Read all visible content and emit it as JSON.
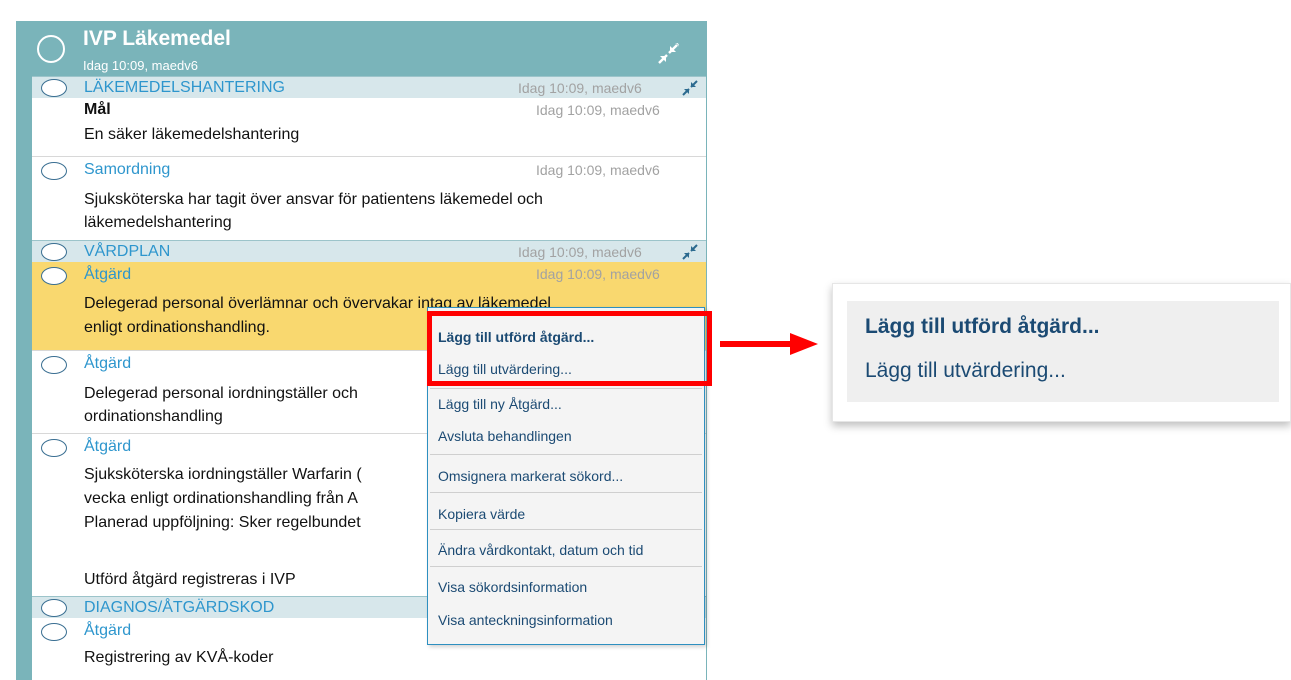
{
  "header": {
    "title": "IVP Läkemedel",
    "meta": "Idag 10:09, maedv6",
    "collapse_icon": "collapse-arrows-icon",
    "color": "#7ab4ba"
  },
  "sections": [
    {
      "title": "LÄKEMEDELSHANTERING",
      "meta": "Idag 10:09, maedv6",
      "rows": [
        {
          "label": "Mål",
          "meta": "Idag 10:09, maedv6",
          "lines": [
            "En säker läkemedelshantering"
          ]
        },
        {
          "label": "Samordning",
          "meta": "Idag 10:09, maedv6",
          "lines": [
            "Sjuksköterska har tagit över ansvar för patientens läkemedel och",
            "läkemedelshantering"
          ]
        }
      ]
    },
    {
      "title": "VÅRDPLAN",
      "meta": "Idag 10:09, maedv6",
      "rows": [
        {
          "label": "Åtgärd",
          "meta": "Idag 10:09, maedv6",
          "lines": [
            "Delegerad personal överlämnar och övervakar intag av läkemedel",
            "enligt ordinationshandling."
          ]
        },
        {
          "label": "Åtgärd",
          "meta": "",
          "lines": [
            "Delegerad personal iordningställer och",
            "ordinationshandling"
          ]
        },
        {
          "label": "Åtgärd",
          "meta": "",
          "lines": [
            "Sjuksköterska iordningställer Warfarin (",
            "vecka enligt ordinationshandling från A",
            "Planerad uppföljning: Sker regelbundet",
            "",
            "Utförd åtgärd registreras i IVP"
          ]
        }
      ]
    },
    {
      "title": "DIAGNOS/ÅTGÄRDSKOD",
      "rows": [
        {
          "label": "Åtgärd",
          "lines": [
            "Registrering av KVÅ-koder"
          ]
        }
      ]
    }
  ],
  "context_menu": {
    "items": [
      "Lägg till utförd åtgärd...",
      "Lägg till utvärdering...",
      "Lägg till ny Åtgärd...",
      "Avsluta behandlingen",
      "Omsignera markerat sökord...",
      "Kopiera värde",
      "Ändra vårdkontakt, datum och tid",
      "Visa sökordsinformation",
      "Visa anteckningsinformation"
    ]
  },
  "zoom": {
    "items": [
      "Lägg till utförd åtgärd...",
      "Lägg till utvärdering..."
    ]
  },
  "colors": {
    "accent_blue": "#2e96cd",
    "highlight": "#f9d86f",
    "callout_red": "#ff0000",
    "menu_text": "#1b4a73"
  }
}
